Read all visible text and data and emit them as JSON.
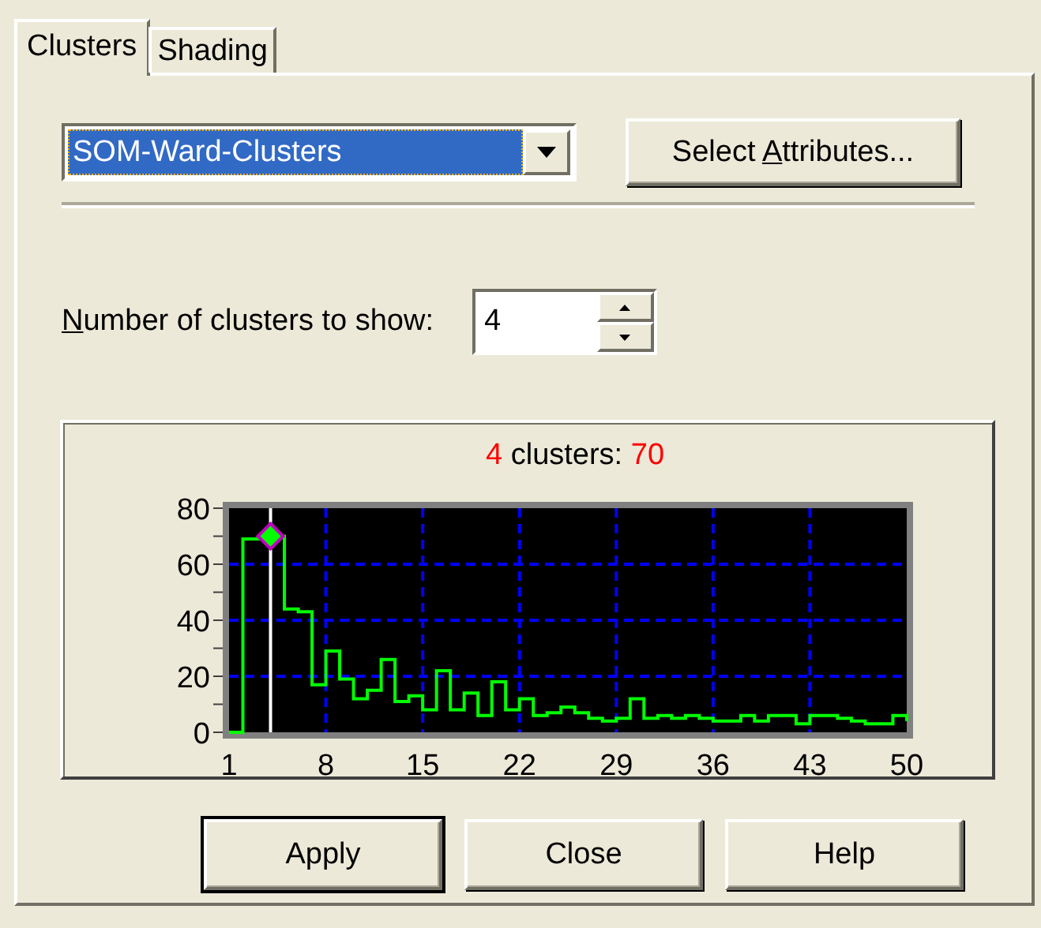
{
  "tabs": [
    {
      "label": "Clusters",
      "selected": true
    },
    {
      "label": "Shading",
      "selected": false
    }
  ],
  "cluster_set": {
    "value": "SOM-Ward-Clusters",
    "focused": true
  },
  "select_attributes_button": {
    "label": "Select Attributes..."
  },
  "cluster_count": {
    "label": "Number of clusters to show:",
    "value": "4"
  },
  "readout": {
    "count": "4",
    "label": "clusters:",
    "value": "70"
  },
  "chart_data": {
    "type": "line",
    "x": [
      1,
      2,
      2,
      3,
      3,
      4,
      4,
      5,
      5,
      6,
      6,
      7,
      7,
      8,
      8,
      9,
      9,
      10,
      10,
      11,
      11,
      12,
      12,
      13,
      13,
      14,
      14,
      15,
      15,
      16,
      16,
      17,
      17,
      18,
      18,
      19,
      19,
      20,
      20,
      21,
      21,
      22,
      22,
      23,
      23,
      24,
      24,
      25,
      25,
      26,
      26,
      27,
      27,
      28,
      28,
      29,
      29,
      30,
      30,
      31,
      31,
      32,
      32,
      33,
      33,
      34,
      34,
      35,
      35,
      36,
      36,
      37,
      37,
      38,
      38,
      39,
      39,
      40,
      40,
      41,
      41,
      42,
      42,
      43,
      43,
      44,
      44,
      45,
      45,
      46,
      46,
      47,
      47,
      48,
      48,
      49,
      49,
      50,
      50
    ],
    "series": [
      {
        "color": "#00ff00",
        "values": [
          0,
          0,
          69,
          69,
          69,
          69,
          70,
          70,
          44,
          44,
          43,
          43,
          17,
          17,
          29,
          29,
          19,
          19,
          12,
          12,
          15,
          15,
          26,
          26,
          11,
          11,
          13,
          13,
          8,
          8,
          22,
          22,
          8,
          8,
          14,
          14,
          6,
          6,
          18,
          18,
          8,
          8,
          12,
          12,
          6,
          6,
          7,
          7,
          9,
          9,
          7,
          7,
          5,
          5,
          4,
          4,
          5,
          5,
          12,
          12,
          5,
          5,
          6,
          6,
          5,
          5,
          6,
          6,
          5,
          5,
          4,
          4,
          4,
          4,
          6,
          6,
          4,
          4,
          6,
          6,
          6,
          6,
          3,
          3,
          6,
          6,
          6,
          6,
          5,
          5,
          4,
          4,
          3,
          3,
          3,
          3,
          6,
          6,
          4
        ]
      },
      {
        "color": "#00ff00",
        "marker": "diamond",
        "values": [
          null,
          null,
          null,
          null,
          null,
          null,
          70,
          null,
          null,
          null,
          null,
          null,
          null,
          null,
          null,
          null,
          null,
          null,
          null,
          null,
          null,
          null,
          null,
          null,
          null,
          null,
          null,
          null,
          null,
          null,
          null,
          null,
          null,
          null,
          null,
          null,
          null,
          null,
          null,
          null,
          null,
          null,
          null,
          null,
          null,
          null,
          null,
          null,
          null,
          null,
          null,
          null,
          null,
          null,
          null,
          null,
          null,
          null,
          null,
          null,
          null,
          null,
          null,
          null,
          null,
          null,
          null,
          null,
          null,
          null,
          null,
          null,
          null,
          null,
          null,
          null,
          null,
          null,
          null,
          null,
          null,
          null,
          null,
          null,
          null,
          null,
          null,
          null,
          null,
          null,
          null,
          null,
          null,
          null,
          null,
          null,
          null,
          null,
          null
        ]
      }
    ],
    "grid": true,
    "ref_lines": [
      {
        "axis": "x",
        "value": 4,
        "color": "#ffffff"
      }
    ],
    "xlim": [
      1,
      50
    ],
    "ylim": [
      0,
      80
    ],
    "xticks": [
      1,
      8,
      15,
      22,
      29,
      36,
      43,
      50
    ],
    "yticks": [
      0,
      20,
      40,
      60,
      80
    ]
  },
  "buttons": [
    {
      "label": "Apply",
      "default": true
    },
    {
      "label": "Close",
      "default": false
    },
    {
      "label": "Help",
      "default": false
    }
  ]
}
